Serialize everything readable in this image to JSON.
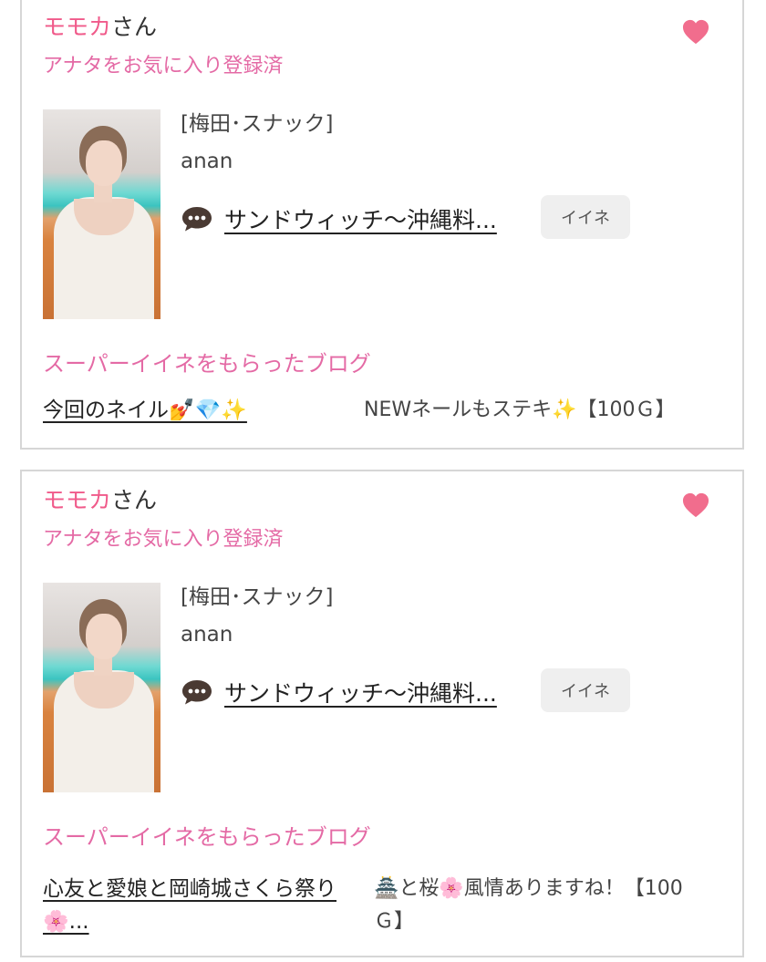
{
  "cards": [
    {
      "name": "モモカ",
      "name_suffix": "さん",
      "favorite_status": "アナタをお気に入り登録済",
      "category": "[梅田･スナック]",
      "shop": "anan",
      "blog_link": "サンドウィッチ〜沖縄料理〜",
      "blog_link_display": "サンドウィッチ〜沖縄料...",
      "like_label": "イイネ",
      "super_like_title": "スーパーイイネをもらったブログ",
      "super_blog_title": "今回のネイル💅💎✨",
      "super_comment": "NEWネールもステキ✨【100Ｇ】"
    },
    {
      "name": "モモカ",
      "name_suffix": "さん",
      "favorite_status": "アナタをお気に入り登録済",
      "category": "[梅田･スナック]",
      "shop": "anan",
      "blog_link": "サンドウィッチ〜沖縄料理〜",
      "blog_link_display": "サンドウィッチ〜沖縄料...",
      "like_label": "イイネ",
      "super_like_title": "スーパーイイネをもらったブログ",
      "super_blog_title": "心友と愛娘と岡崎城さくら祭り🌸...",
      "super_comment": "🏯と桜🌸風情ありますね！【100Ｇ】"
    }
  ],
  "icons": {
    "favorite": "heart-icon",
    "comment": "chat-bubble-icon"
  },
  "colors": {
    "name": "#f05a8a",
    "accent": "#e46aa5",
    "heart": "#f16d8d"
  }
}
